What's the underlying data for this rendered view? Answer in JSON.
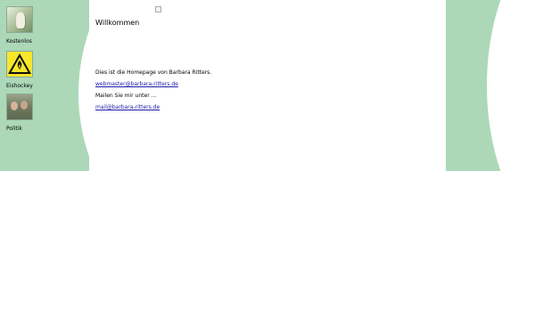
{
  "colors": {
    "background_band": "#acd8b8",
    "link": "#1a1aa6"
  },
  "nav": {
    "items": [
      {
        "label": "Kostenlos",
        "icon": "seal-image"
      },
      {
        "label": "Eishockey",
        "icon": "warning-sign-image"
      },
      {
        "label": "Politik",
        "icon": "people-photo"
      }
    ]
  },
  "main": {
    "title": "Willkommen",
    "intro": "Dies ist die Homepage von Barbara Ritters.",
    "webmaster_email": "webmaster@barbara-ritters.de",
    "mail_prompt": "Mailen Sie mir unter ...",
    "mail_email": "mail@barbara-ritters.de"
  }
}
